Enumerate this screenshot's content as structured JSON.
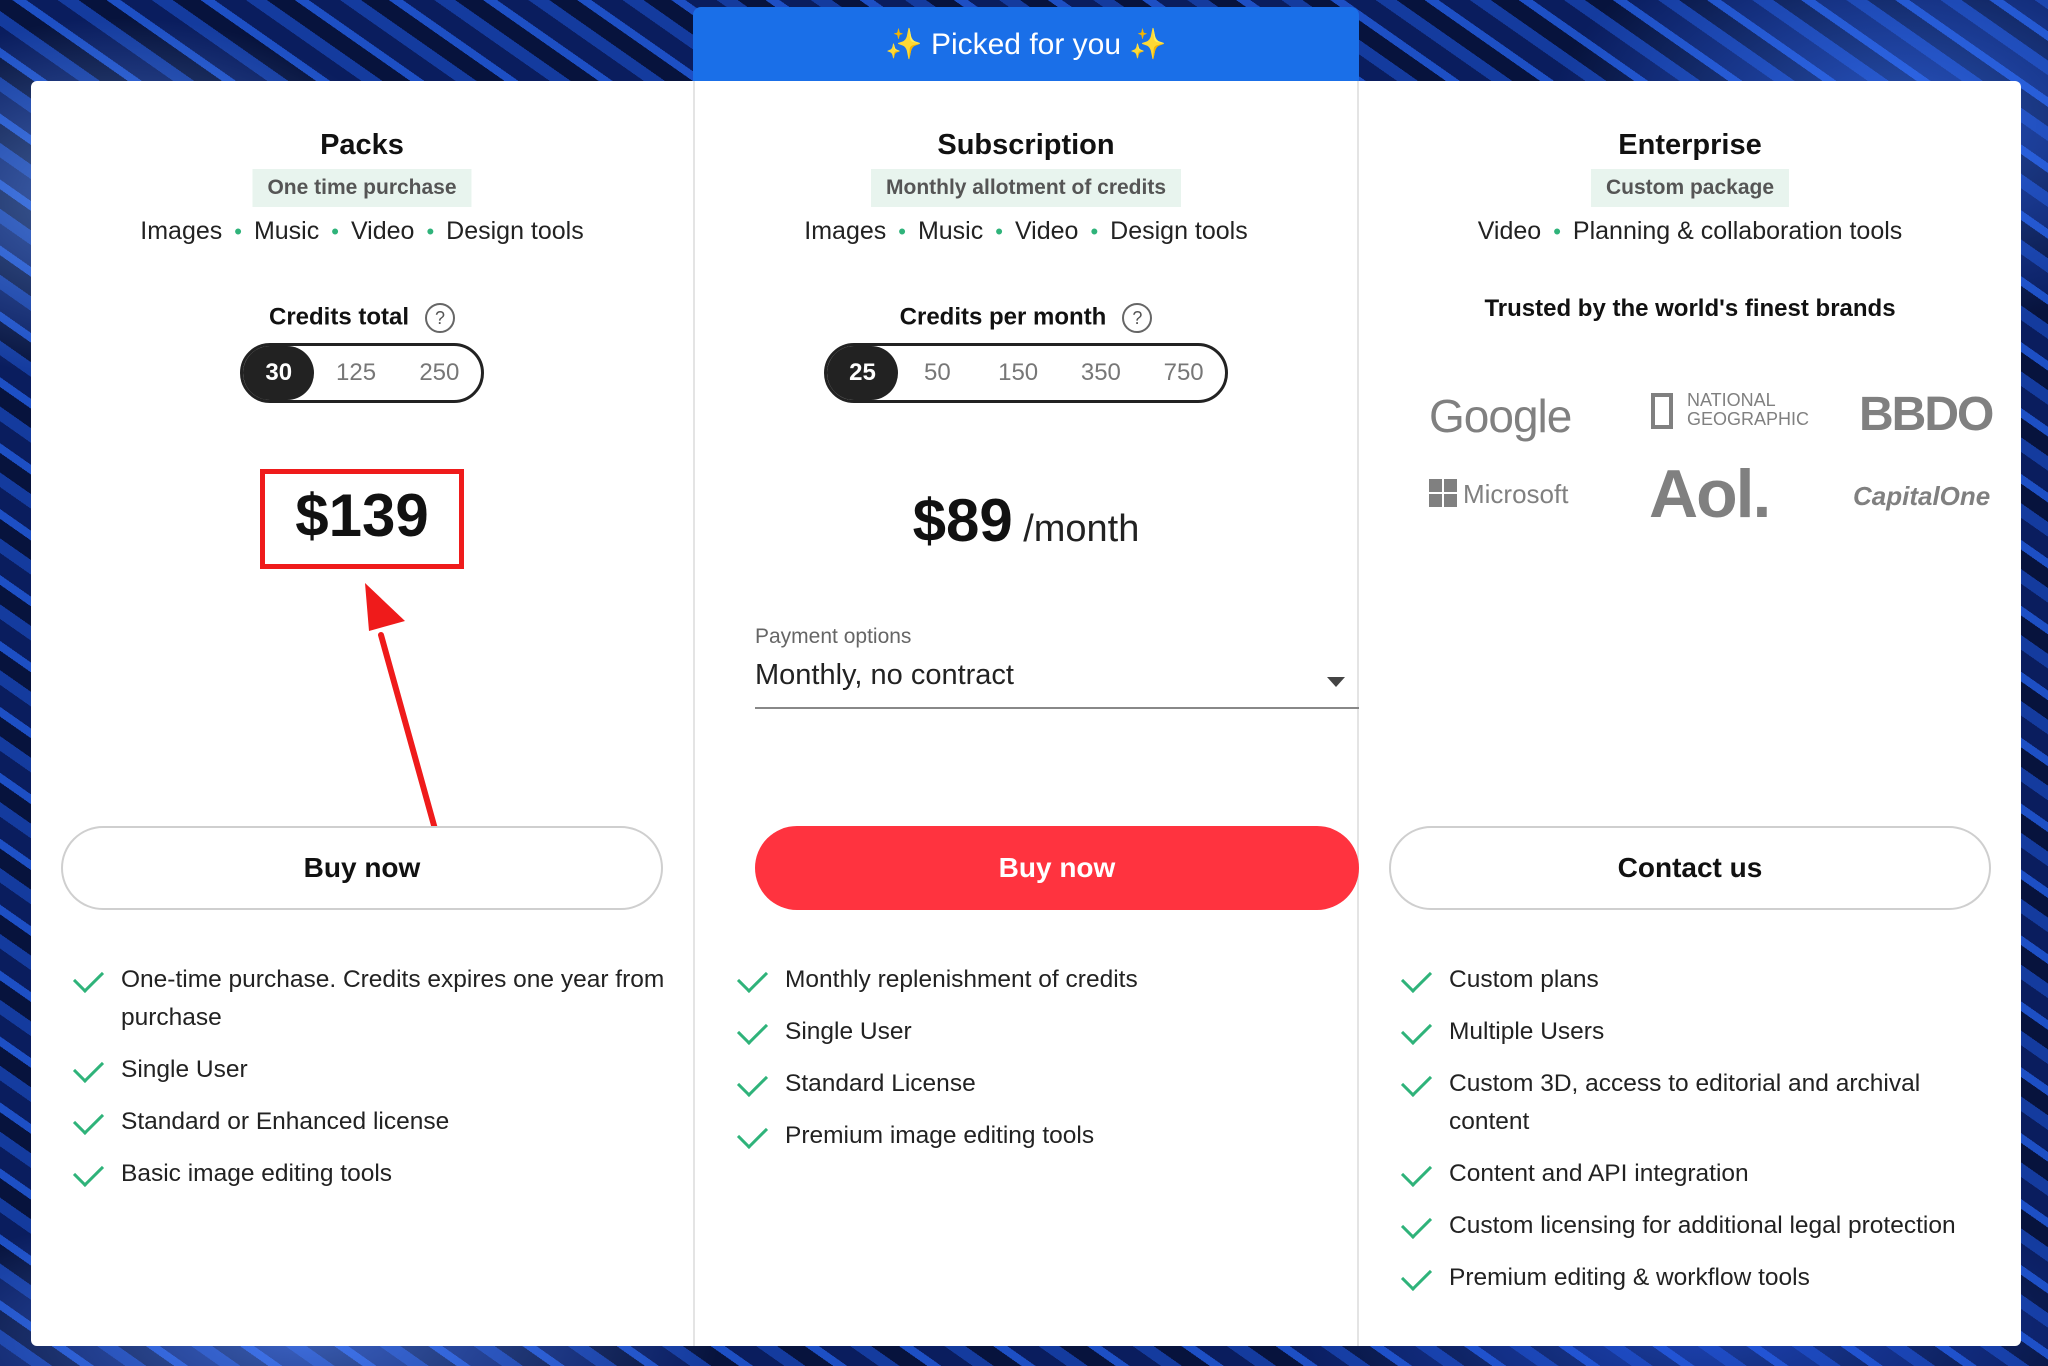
{
  "banner": {
    "label": "✨ Picked for you ✨"
  },
  "packs": {
    "title": "Packs",
    "tag": "One time purchase",
    "features": [
      "Images",
      "Music",
      "Video",
      "Design tools"
    ],
    "credits_label": "Credits total",
    "options": [
      "30",
      "125",
      "250"
    ],
    "selected": "30",
    "price": "$139",
    "button": "Buy now",
    "benefits": [
      "One-time purchase. Credits expires one year from purchase",
      "Single User",
      "Standard or Enhanced license",
      "Basic image editing tools"
    ]
  },
  "subscription": {
    "title": "Subscription",
    "tag": "Monthly allotment of credits",
    "features": [
      "Images",
      "Music",
      "Video",
      "Design tools"
    ],
    "credits_label": "Credits per month",
    "options": [
      "25",
      "50",
      "150",
      "350",
      "750"
    ],
    "selected": "25",
    "price": "$89",
    "price_suffix": "/month",
    "payment_label": "Payment options",
    "payment_value": "Monthly, no contract",
    "button": "Buy now",
    "benefits": [
      "Monthly replenishment of credits",
      "Single User",
      "Standard License",
      "Premium image editing tools"
    ]
  },
  "enterprise": {
    "title": "Enterprise",
    "tag": "Custom package",
    "features": [
      "Video",
      "Planning & collaboration tools"
    ],
    "trusted": "Trusted by the world's finest brands",
    "brands": [
      "Google",
      "NATIONAL GEOGRAPHIC",
      "BBDO",
      "Microsoft",
      "Aol.",
      "CapitalOne"
    ],
    "button": "Contact us",
    "benefits": [
      "Custom plans",
      "Multiple Users",
      "Custom 3D, access to editorial and archival content",
      "Content and API integration",
      "Custom licensing for additional legal protection",
      "Premium editing & workflow tools"
    ]
  },
  "colors": {
    "accent_blue": "#1a6fe8",
    "buy_red": "#ff333f",
    "check_green": "#2fb37a",
    "annotation_red": "#ef1b1b"
  }
}
